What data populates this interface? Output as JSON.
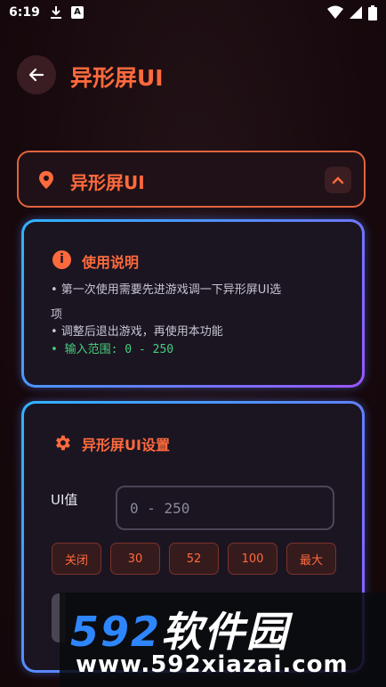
{
  "status_bar": {
    "time": "6:19",
    "a_badge": "A"
  },
  "header": {
    "title": "异形屏UI"
  },
  "section": {
    "title": "异形屏UI"
  },
  "info_card": {
    "title": "使用说明",
    "lines": [
      "• 第一次使用需要先进游戏调一下异形屏UI选",
      "项",
      "• 调整后退出游戏，再使用本功能",
      "• 输入范围: 0 - 250"
    ]
  },
  "settings_card": {
    "title": "异形屏UI设置",
    "ui_label": "UI值",
    "input_placeholder": "0 - 250",
    "input_value": "",
    "presets": [
      "关闭",
      "30",
      "52",
      "100",
      "最大"
    ]
  },
  "watermark": {
    "num": "592",
    "cn": "软件园",
    "url": "www.592xiazai.com"
  },
  "colors": {
    "accent": "#ff6a3d",
    "card_border_start": "#2fb4ff",
    "card_border_end": "#9a55ff",
    "range_text": "#44d07a"
  }
}
